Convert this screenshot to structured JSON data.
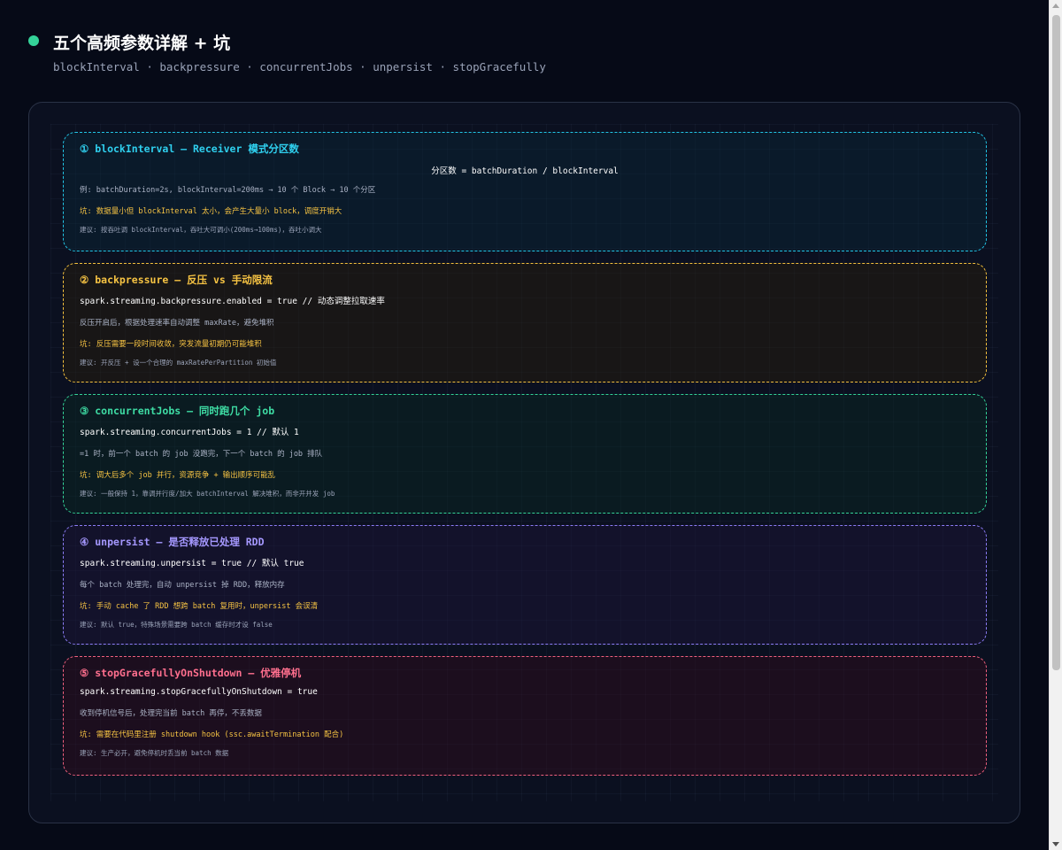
{
  "header": {
    "title": "五个高频参数详解 + 坑",
    "subtitle": "blockInterval · backpressure · concurrentJobs · unpersist · stopGracefully"
  },
  "cards": [
    {
      "title": "① blockInterval — Receiver 模式分区数",
      "formula": "分区数 = batchDuration / blockInterval",
      "desc": "例: batchDuration=2s, blockInterval=200ms → 10 个 Block → 10 个分区",
      "pit": "坑: 数据量小但 blockInterval 太小，会产生大量小 block，调度开销大",
      "advice": "建议: 按吞吐调 blockInterval，吞吐大可调小(200ms→100ms)，吞吐小调大"
    },
    {
      "title": "② backpressure — 反压 vs 手动限流",
      "code": "spark.streaming.backpressure.enabled = true // 动态调整拉取速率",
      "desc": "反压开启后，根据处理速率自动调整 maxRate，避免堆积",
      "pit": "坑: 反压需要一段时间收敛，突发流量初期仍可能堆积",
      "advice": "建议: 开反压 + 设一个合理的 maxRatePerPartition 初始值"
    },
    {
      "title": "③ concurrentJobs — 同时跑几个 job",
      "code": "spark.streaming.concurrentJobs = 1 // 默认 1",
      "desc": "=1 时，前一个 batch 的 job 没跑完，下一个 batch 的 job 排队",
      "pit": "坑: 调大后多个 job 并行，资源竞争 + 输出顺序可能乱",
      "advice": "建议: 一般保持 1，靠调并行度/加大 batchInterval 解决堆积，而非开并发 job"
    },
    {
      "title": "④ unpersist — 是否释放已处理 RDD",
      "code": "spark.streaming.unpersist = true // 默认 true",
      "desc": "每个 batch 处理完，自动 unpersist 掉 RDD，释放内存",
      "pit": "坑: 手动 cache 了 RDD 想跨 batch 复用时，unpersist 会误清",
      "advice": "建议: 默认 true，特殊场景需要跨 batch 缓存时才设 false"
    },
    {
      "title": "⑤ stopGracefullyOnShutdown — 优雅停机",
      "code": "spark.streaming.stopGracefullyOnShutdown = true",
      "desc": "收到停机信号后，处理完当前 batch 再停，不丢数据",
      "pit": "坑: 需要在代码里注册 shutdown hook (ssc.awaitTermination 配合)",
      "advice": "建议: 生产必开，避免停机时丢当前 batch 数据"
    }
  ]
}
